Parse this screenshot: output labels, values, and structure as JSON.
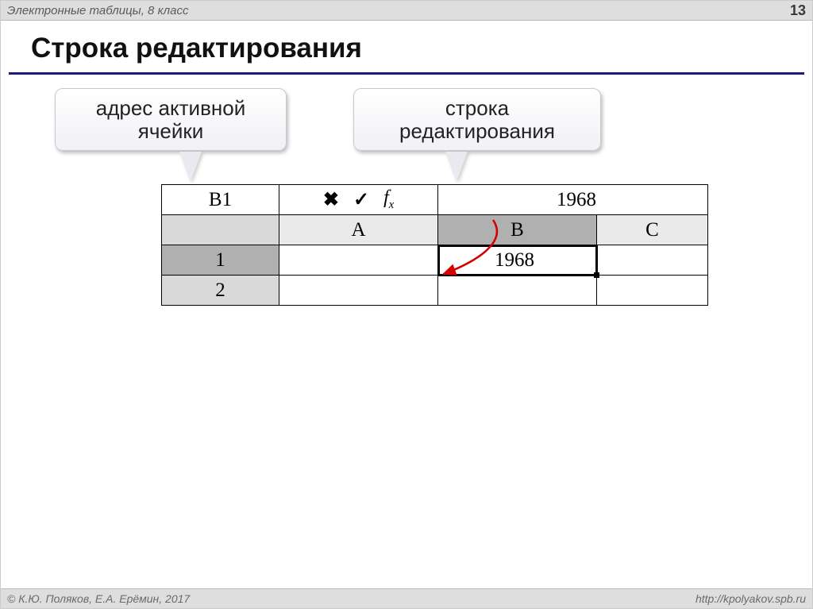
{
  "header": {
    "topic": "Электронные таблицы, 8 класс",
    "page_number": "13"
  },
  "title": "Строка редактирования",
  "callouts": {
    "address_label": "адрес активной ячейки",
    "formula_bar_label": "строка редактирования"
  },
  "formula_bar": {
    "name_box": "B1",
    "cancel_icon": "✖",
    "confirm_icon": "✓",
    "fx_label": "f",
    "fx_sub": "x",
    "value": "1968"
  },
  "grid": {
    "columns": [
      "A",
      "B",
      "C"
    ],
    "rows": [
      "1",
      "2"
    ],
    "active_column": "B",
    "active_row": "1",
    "active_cell_value": "1968"
  },
  "footer": {
    "copyright": "© К.Ю. Поляков, Е.А. Ерёмин, 2017",
    "url": "http://kpolyakov.spb.ru"
  }
}
